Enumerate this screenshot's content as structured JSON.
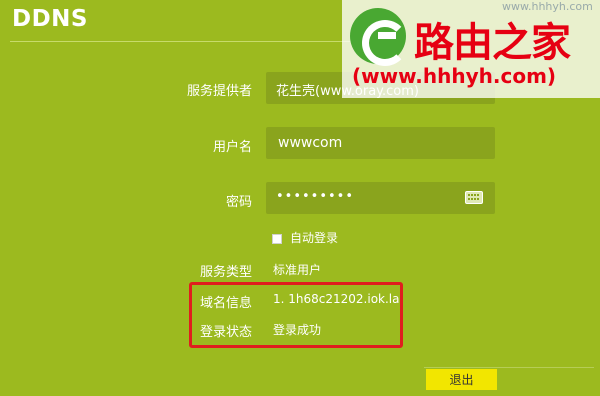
{
  "header": {
    "title": "DDNS"
  },
  "form": {
    "provider": {
      "label": "服务提供者",
      "value": "花生壳(www.oray.com)"
    },
    "username": {
      "label": "用户名",
      "value": "wwwcom"
    },
    "password": {
      "label": "密码",
      "value": "•••••••••"
    },
    "auto_login": {
      "label": "自动登录",
      "checked": false
    },
    "service_type": {
      "label": "服务类型",
      "value": "标准用户"
    },
    "domain_info": {
      "label": "域名信息",
      "value": "1. 1h68c21202.iok.la"
    },
    "login_status": {
      "label": "登录状态",
      "value": "登录成功"
    }
  },
  "actions": {
    "logout_label": "退出"
  },
  "watermark": {
    "brand_cn": "路由之家",
    "brand_url": "(www.hhhyh.com)",
    "top_text": "www.hhhyh.com"
  },
  "colors": {
    "background": "#9cba1f",
    "field_bg": "#8aa41d",
    "highlight_border": "#e01e1e",
    "logout_bg": "#f2e600",
    "watermark_red": "#e60012",
    "watermark_green": "#49a832"
  }
}
